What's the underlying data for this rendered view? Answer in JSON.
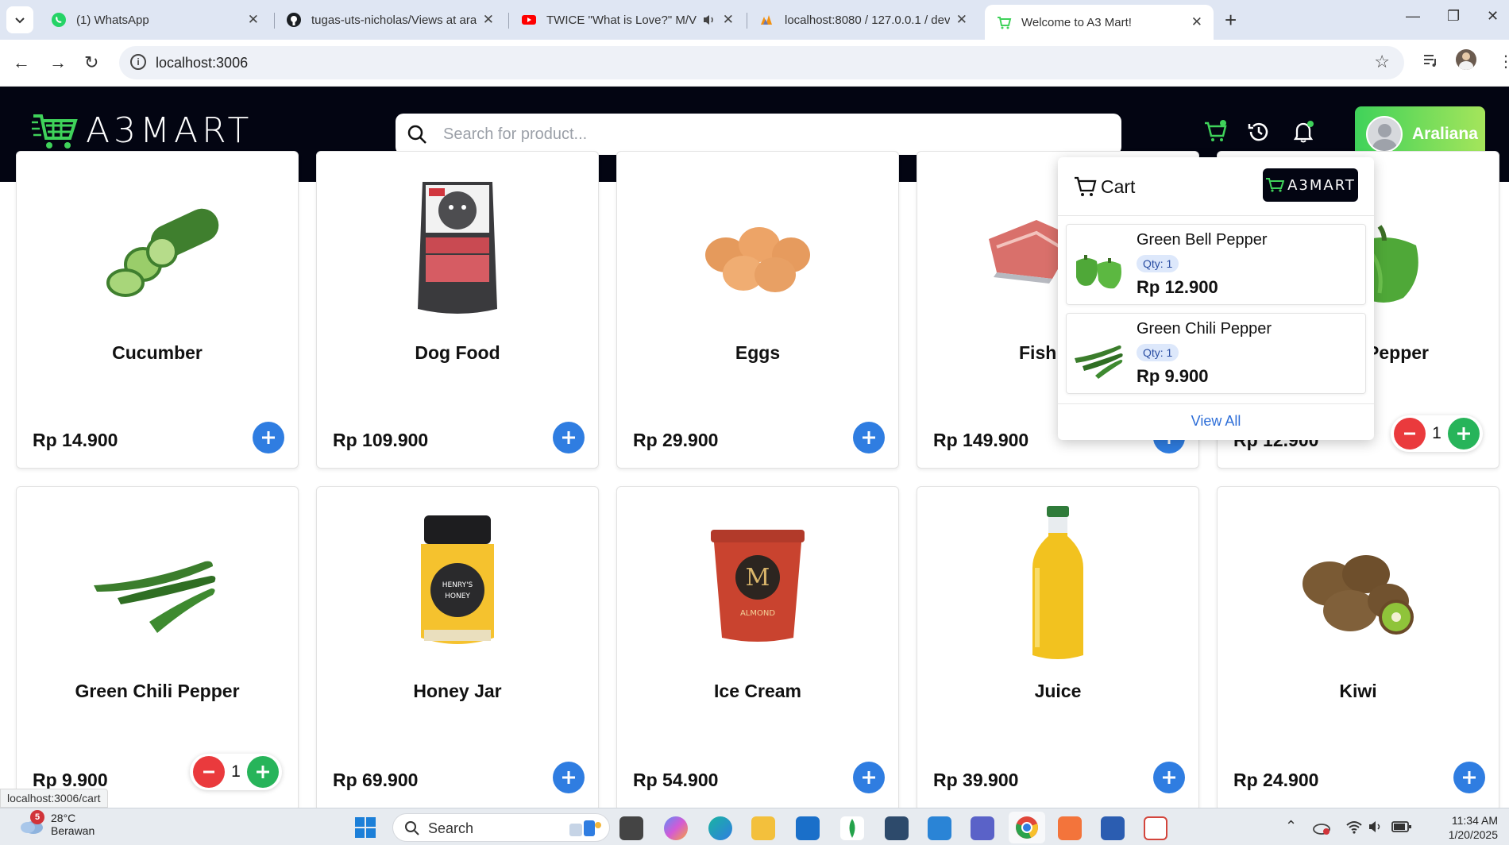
{
  "browser": {
    "tabs": [
      {
        "title": "(1) WhatsApp",
        "icon": "whatsapp-icon"
      },
      {
        "title": "tugas-uts-nicholas/Views at ara",
        "icon": "github-icon"
      },
      {
        "title": "TWICE \"What is Love?\" M/V",
        "icon": "youtube-icon"
      },
      {
        "title": "localhost:8080 / 127.0.0.1 / dev",
        "icon": "phpmyadmin-icon"
      },
      {
        "title": "Welcome to A3 Mart!",
        "icon": "a3mart-icon"
      }
    ],
    "url": "localhost:3006",
    "status_url": "localhost:3006/cart"
  },
  "header": {
    "logo_text": "A3MART",
    "search_placeholder": "Search for product...",
    "username": "Araliana"
  },
  "products_row1": [
    {
      "name": "Cucumber",
      "price": "Rp 14.900"
    },
    {
      "name": "Dog Food",
      "price": "Rp 109.900"
    },
    {
      "name": "Eggs",
      "price": "Rp 29.900"
    },
    {
      "name": "Fish S",
      "price": "Rp 149.900"
    },
    {
      "name": "Pepper",
      "price": "Rp 12.900",
      "qty": "1"
    }
  ],
  "products_row2": [
    {
      "name": "Green Chili Pepper",
      "price": "Rp 9.900",
      "qty": "1"
    },
    {
      "name": "Honey Jar",
      "price": "Rp 69.900"
    },
    {
      "name": "Ice Cream",
      "price": "Rp 54.900"
    },
    {
      "name": "Juice",
      "price": "Rp 39.900"
    },
    {
      "name": "Kiwi",
      "price": "Rp 24.900"
    }
  ],
  "cart": {
    "title": "Cart",
    "logo_text": "A3MART",
    "items": [
      {
        "name": "Green Bell Pepper",
        "qty": "Qty: 1",
        "price": "Rp 12.900"
      },
      {
        "name": "Green Chili Pepper",
        "qty": "Qty: 1",
        "price": "Rp 9.900"
      }
    ],
    "view_all": "View All"
  },
  "taskbar": {
    "weather_badge": "5",
    "temperature": "28°C",
    "condition": "Berawan",
    "search_label": "Search",
    "time": "11:34 AM",
    "date": "1/20/2025"
  },
  "colors": {
    "header_bg": "#030512",
    "accent_green": "#3fd25a",
    "add_button_blue": "#2f7de1",
    "minus_red": "#ea3a3d",
    "plus_green": "#27b45a"
  }
}
